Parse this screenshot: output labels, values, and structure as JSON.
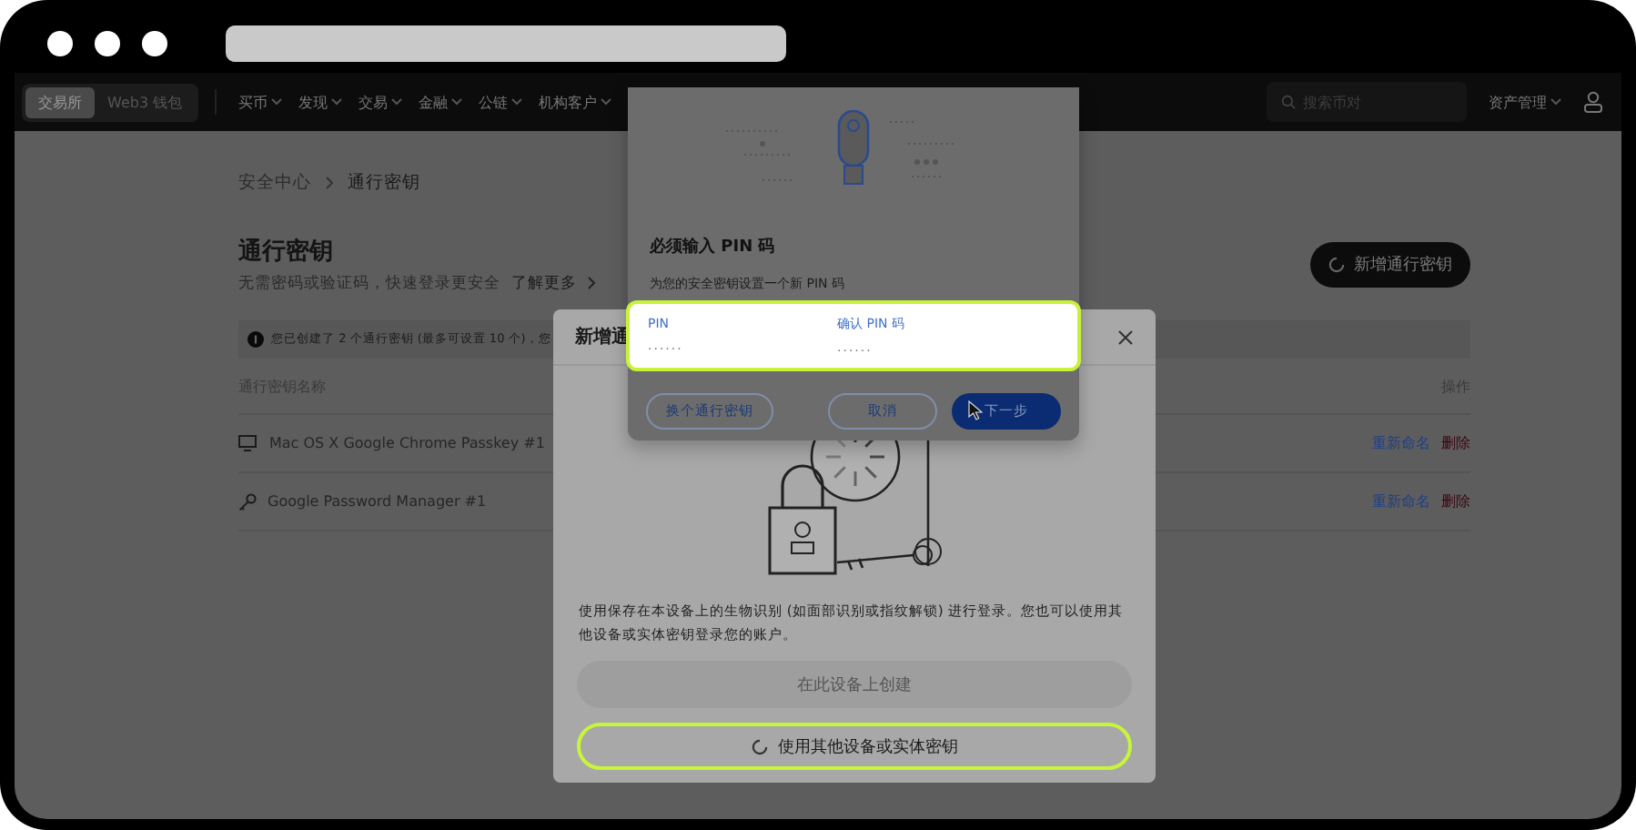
{
  "nav": {
    "tabs": [
      {
        "label": "交易所",
        "selected": true
      },
      {
        "label": "Web3 钱包",
        "selected": false
      }
    ],
    "menu": [
      "买币",
      "发现",
      "交易",
      "金融",
      "公链",
      "机构客户"
    ],
    "search": {
      "placeholder": "搜索币对"
    },
    "assets": "资产管理"
  },
  "breadcrumb": [
    "安全中心",
    "通行密钥"
  ],
  "page": {
    "title": "通行密钥",
    "subtitle": "无需密码或验证码，快速登录更安全",
    "learn_more": "了解更多",
    "add_button": "新增通行密钥",
    "notice": "您已创建了 2 个通行密钥 (最多可设置 10 个)，您",
    "columns": [
      "通行密钥名称",
      "操作"
    ],
    "rows": [
      {
        "kind": "device",
        "name": "Mac OS X Google Chrome Passkey #1",
        "rename": "重新命名",
        "delete": "删除"
      },
      {
        "kind": "key",
        "name": "Google Password Manager #1",
        "rename": "重新命名",
        "delete": "删除"
      }
    ]
  },
  "modal": {
    "title": "新增通",
    "description": "使用保存在本设备上的生物识别 (如面部识别或指纹解锁) 进行登录。您也可以使用其他设备或实体密钥登录您的账户。",
    "create_button": {
      "label": "在此设备上创建",
      "disabled": true
    },
    "other_button": {
      "label": "使用其他设备或实体密钥",
      "disabled": false
    }
  },
  "pin_dialog": {
    "title": "必须输入 PIN 码",
    "subtitle": "为您的安全密钥设置一个新 PIN 码",
    "fields": [
      {
        "label": "PIN",
        "value": "······"
      },
      {
        "label": "确认 PIN 码",
        "value": "······"
      }
    ],
    "buttons": [
      {
        "kind": "outline",
        "label": "换个通行密钥"
      },
      {
        "kind": "outline",
        "label": "取消"
      },
      {
        "kind": "primary",
        "label": "下一步"
      }
    ]
  }
}
